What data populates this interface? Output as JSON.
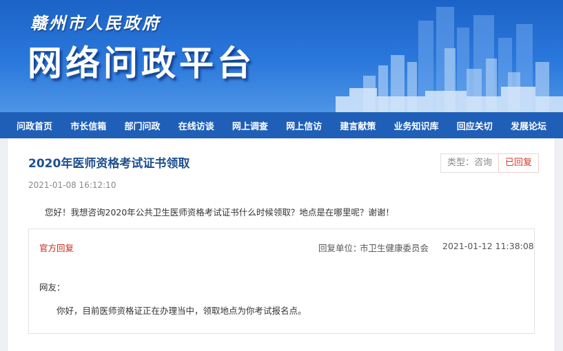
{
  "banner": {
    "gov_name": "赣州市人民政府",
    "platform_name": "网络问政平台"
  },
  "nav": {
    "items": [
      "问政首页",
      "市长信箱",
      "部门问政",
      "在线访谈",
      "网上调查",
      "网上信访",
      "建言献策",
      "业务知识库",
      "回应关切",
      "发展论坛"
    ]
  },
  "post": {
    "title": "2020年医师资格考试证书领取",
    "type_badge": "类型：咨询",
    "status_badge": "已回复",
    "timestamp": "2021-01-08 16:12:10",
    "question": "您好！我想咨询2020年公共卫生医师资格考试证书什么时候领取？地点是在哪里呢？谢谢！"
  },
  "reply": {
    "label": "官方回复",
    "unit_label": "回复单位：",
    "unit": "市卫生健康委员会",
    "time": "2021-01-12 11:38:08",
    "greeting": "网友：",
    "text": "你好，目前医师资格证正在办理当中，领取地点为你考试报名点。"
  },
  "colors": {
    "nav_bg": "#1f5fb8",
    "title": "#1d4f8f",
    "status_red": "#d33a2c"
  }
}
